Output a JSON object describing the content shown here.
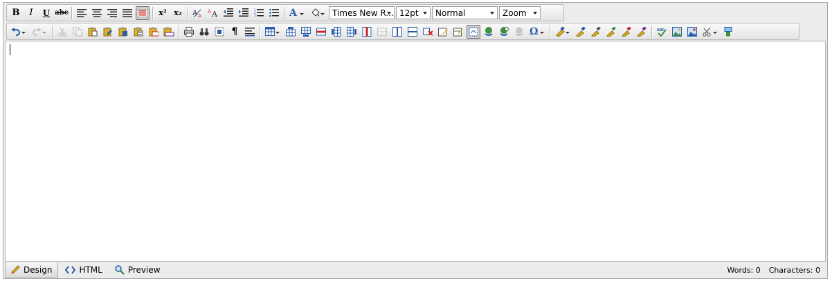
{
  "toolbar1": {
    "bold": "B",
    "italic": "I",
    "underline": "U",
    "strike": "abc",
    "superscript": "x²",
    "subscript": "x₂",
    "fore_color": "A",
    "font_name": "Times New R...",
    "font_size": "12pt",
    "paragraph_format": "Normal",
    "zoom": "Zoom"
  },
  "toolbar2": {
    "paragraph_mark": "¶",
    "special_char": "Ω"
  },
  "colors": {
    "accent_blue": "#2a5ca8",
    "accent_green": "#3e8f3e",
    "accent_yellow": "#e0b321",
    "accent_red": "#c22"
  },
  "modes": {
    "design": "Design",
    "html": "HTML",
    "preview": "Preview"
  },
  "stats": {
    "words": "Words: 0",
    "characters": "Characters: 0"
  }
}
